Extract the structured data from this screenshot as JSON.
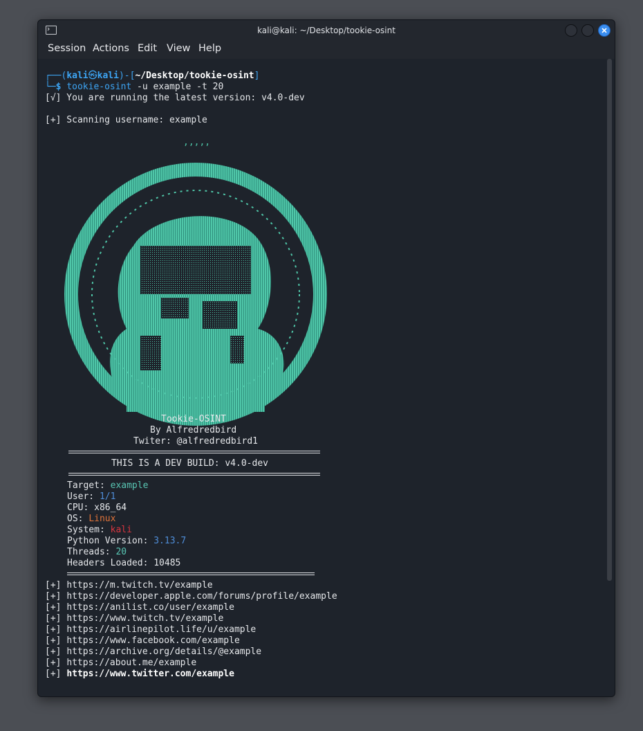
{
  "window": {
    "title": "kali@kali: ~/Desktop/tookie-osint"
  },
  "menu": {
    "items": [
      "Session",
      "Actions",
      "Edit",
      "View",
      "Help"
    ]
  },
  "prompt": {
    "corner_top": "┌──(",
    "user": "kali",
    "at": "㉿",
    "host": "kali",
    "bracket_mid": ")-[",
    "path": "~/Desktop/tookie-osint",
    "bracket_end": "]",
    "corner_bottom": "└─",
    "dollar": "$",
    "command": "tookie-osint",
    "args": " -u example -t 20"
  },
  "output": {
    "version_line": "[√] You are running the latest version: v4.0-dev",
    "scanning_line": "[+] Scanning username: example",
    "art_dots": ",,,,,",
    "banner_name": "Tookie-OSINT",
    "banner_by": "By Alfredredbird",
    "banner_twitter": "Twiter: @alfredredbird1",
    "dev_build": "THIS IS A DEV BUILD: v4.0-dev"
  },
  "info": {
    "target_label": "Target: ",
    "target_value": "example",
    "user_label": "User: ",
    "user_value": "1/1",
    "cpu_label": "CPU: ",
    "cpu_value": "x86_64",
    "os_label": "OS: ",
    "os_value": "Linux",
    "system_label": "System: ",
    "system_value": "kali",
    "python_label": "Python Version: ",
    "python_value": "3.13.7",
    "threads_label": "Threads: ",
    "threads_value": "20",
    "headers_label": "Headers Loaded: ",
    "headers_value": "10485"
  },
  "results": {
    "prefix": "[+]",
    "urls": [
      "https://m.twitch.tv/example",
      "https://developer.apple.com/forums/profile/example",
      "https://anilist.co/user/example",
      "https://www.twitch.tv/example",
      "https://airlinepilot.life/u/example",
      "https://www.facebook.com/example",
      "https://archive.org/details/@example",
      "https://about.me/example",
      "https://www.twitter.com/example"
    ]
  },
  "colors": {
    "accent": "#3da5f4",
    "art": "#4fc6a8",
    "background": "#1e232b"
  }
}
